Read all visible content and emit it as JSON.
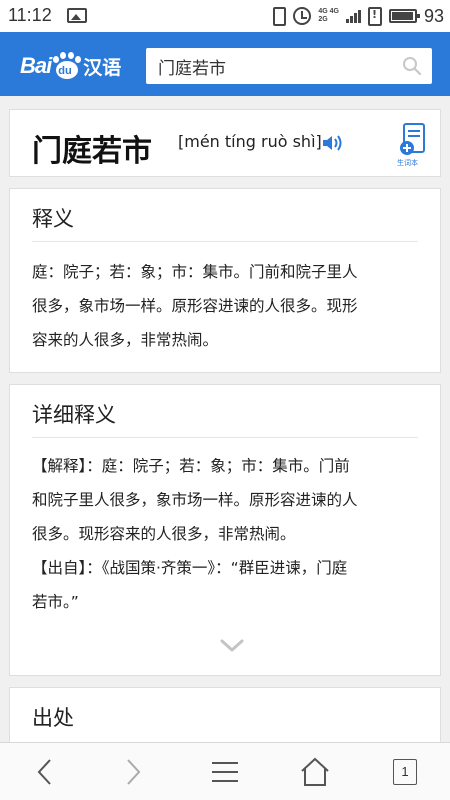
{
  "status_bar": {
    "time": "11:12",
    "network_top": "4G 4G",
    "network_bottom": "2G",
    "battery_percent": "93"
  },
  "header": {
    "logo_bai": "Bai",
    "logo_du": "du",
    "logo_han": "汉语",
    "search_value": "门庭若市"
  },
  "word_card": {
    "word": "门庭若市",
    "pinyin": "[mén tíng ruò shì]",
    "newword_label": "生词本"
  },
  "definition_card": {
    "title": "释义",
    "lines": [
      "庭：院子；若：象；市：集市。门前和院子里人",
      "很多，象市场一样。原形容进谏的人很多。现形",
      "容来的人很多，非常热闹。"
    ]
  },
  "detail_card": {
    "title": "详细释义",
    "lines": [
      "【解释】：庭：院子；若：象；市：集市。门前",
      "和院子里人很多，象市场一样。原形容进谏的人",
      "很多。现形容来的人很多，非常热闹。",
      "【出自】：《战国策·齐策一》：“群臣进谏，门庭",
      "若市。”"
    ]
  },
  "source_card": {
    "title": "出处"
  },
  "bottom_nav": {
    "tab_count": "1"
  },
  "colors": {
    "brand_blue": "#2b79d8",
    "background": "#f0f0f0"
  }
}
